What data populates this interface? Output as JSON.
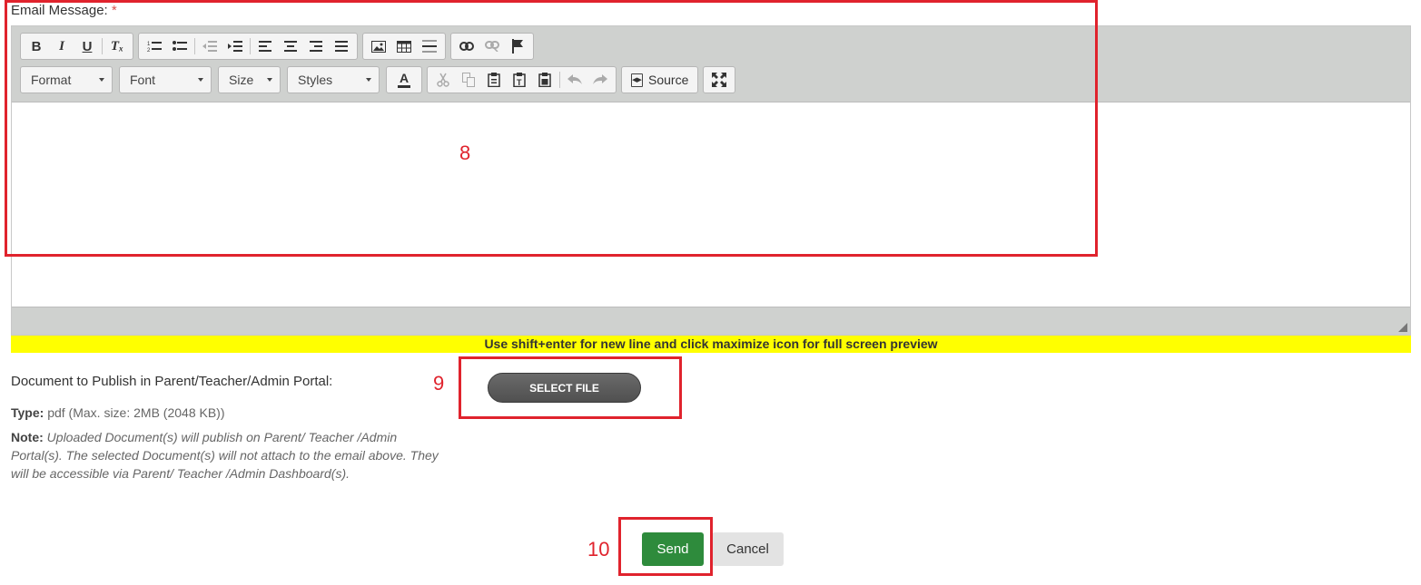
{
  "email": {
    "label": "Email Message:",
    "required_mark": "*"
  },
  "toolbar": {
    "bold": "B",
    "italic": "I",
    "underline": "U",
    "remove_format": "Tₓ",
    "numbered_list": "①",
    "bulleted_list": "•",
    "format_label": "Format",
    "font_label": "Font",
    "size_label": "Size",
    "styles_label": "Styles",
    "text_color": "A",
    "source_label": "Source"
  },
  "hint": "Use shift+enter for new line and click maximize icon for full screen preview",
  "document": {
    "label": "Document to Publish in Parent/Teacher/Admin Portal:",
    "select_file": "SELECT FILE",
    "type_label": "Type:",
    "type_value": "pdf (Max. size: 2MB (2048 KB))",
    "note_label": "Note:",
    "note_text": "Uploaded Document(s) will publish on Parent/ Teacher /Admin Portal(s). The selected Document(s) will not attach to the email above. They will be accessible via Parent/ Teacher /Admin Dashboard(s)."
  },
  "actions": {
    "send": "Send",
    "cancel": "Cancel"
  },
  "annotations": {
    "box8": "8",
    "box9": "9",
    "box10": "10"
  },
  "colors": {
    "annotation": "#e0232d",
    "send": "#2e8b3c",
    "hint_bg": "#ffff00"
  }
}
